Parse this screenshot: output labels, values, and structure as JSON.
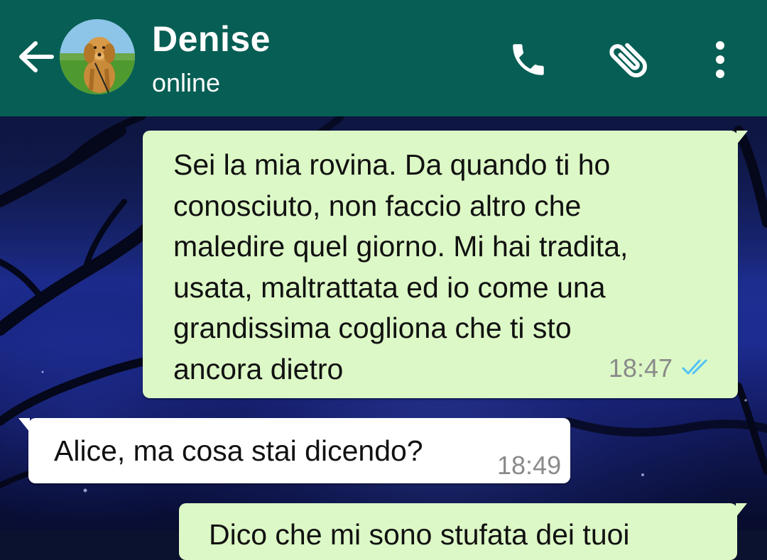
{
  "header": {
    "contact_name": "Denise",
    "status": "online",
    "icons": {
      "back": "back-arrow-icon",
      "avatar": "contact-avatar",
      "call": "phone-icon",
      "attach": "paperclip-icon",
      "menu": "more-vert-icon"
    },
    "color": "#075e54"
  },
  "messages": [
    {
      "direction": "outgoing",
      "text": "Sei la mia rovina. Da quando ti ho\nconosciuto, non faccio altro che\nmaledire quel giorno. Mi hai tradita,\nusata, maltrattata ed io come una\ngrandissima cogliona che ti sto\nancora dietro",
      "time": "18:47",
      "status_icon": "double-check-read-icon"
    },
    {
      "direction": "incoming",
      "text": "Alice, ma cosa stai dicendo?",
      "time": "18:49"
    },
    {
      "direction": "outgoing",
      "text": "Dico che mi sono stufata dei tuoi"
    }
  ],
  "colors": {
    "outgoing_bubble": "#dcf8c6",
    "incoming_bubble": "#ffffff",
    "read_ticks": "#4fc3f7"
  }
}
